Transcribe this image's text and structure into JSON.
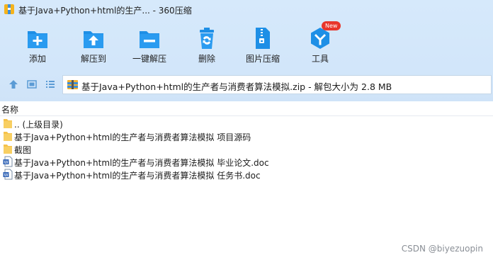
{
  "window": {
    "title": "基于Java+Python+html的生产... - 360压缩"
  },
  "toolbar": {
    "items": [
      {
        "label": "添加",
        "icon": "add-icon"
      },
      {
        "label": "解压到",
        "icon": "extract-to-icon"
      },
      {
        "label": "一键解压",
        "icon": "one-click-extract-icon"
      },
      {
        "label": "删除",
        "icon": "delete-icon"
      },
      {
        "label": "图片压缩",
        "icon": "image-compress-icon"
      },
      {
        "label": "工具",
        "icon": "tools-icon",
        "badge": "New"
      }
    ]
  },
  "address": {
    "text": "基于Java+Python+html的生产者与消费者算法模拟.zip - 解包大小为 2.8 MB"
  },
  "list": {
    "column_name": "名称",
    "rows": [
      {
        "name": ".. (上级目录)",
        "type": "folder"
      },
      {
        "name": "基于Java+Python+html的生产者与消费者算法模拟 项目源码",
        "type": "folder"
      },
      {
        "name": "截图",
        "type": "folder"
      },
      {
        "name": "基于Java+Python+html的生产者与消费者算法模拟 毕业论文.doc",
        "type": "doc"
      },
      {
        "name": "基于Java+Python+html的生产者与消费者算法模拟 任务书.doc",
        "type": "doc"
      }
    ]
  },
  "watermark": "CSDN @biyezuopin",
  "colors": {
    "accent": "#1e8fe6",
    "toolbar_bg": "#d4e7fa",
    "badge": "#e8352b",
    "folder": "#f5c24a"
  }
}
